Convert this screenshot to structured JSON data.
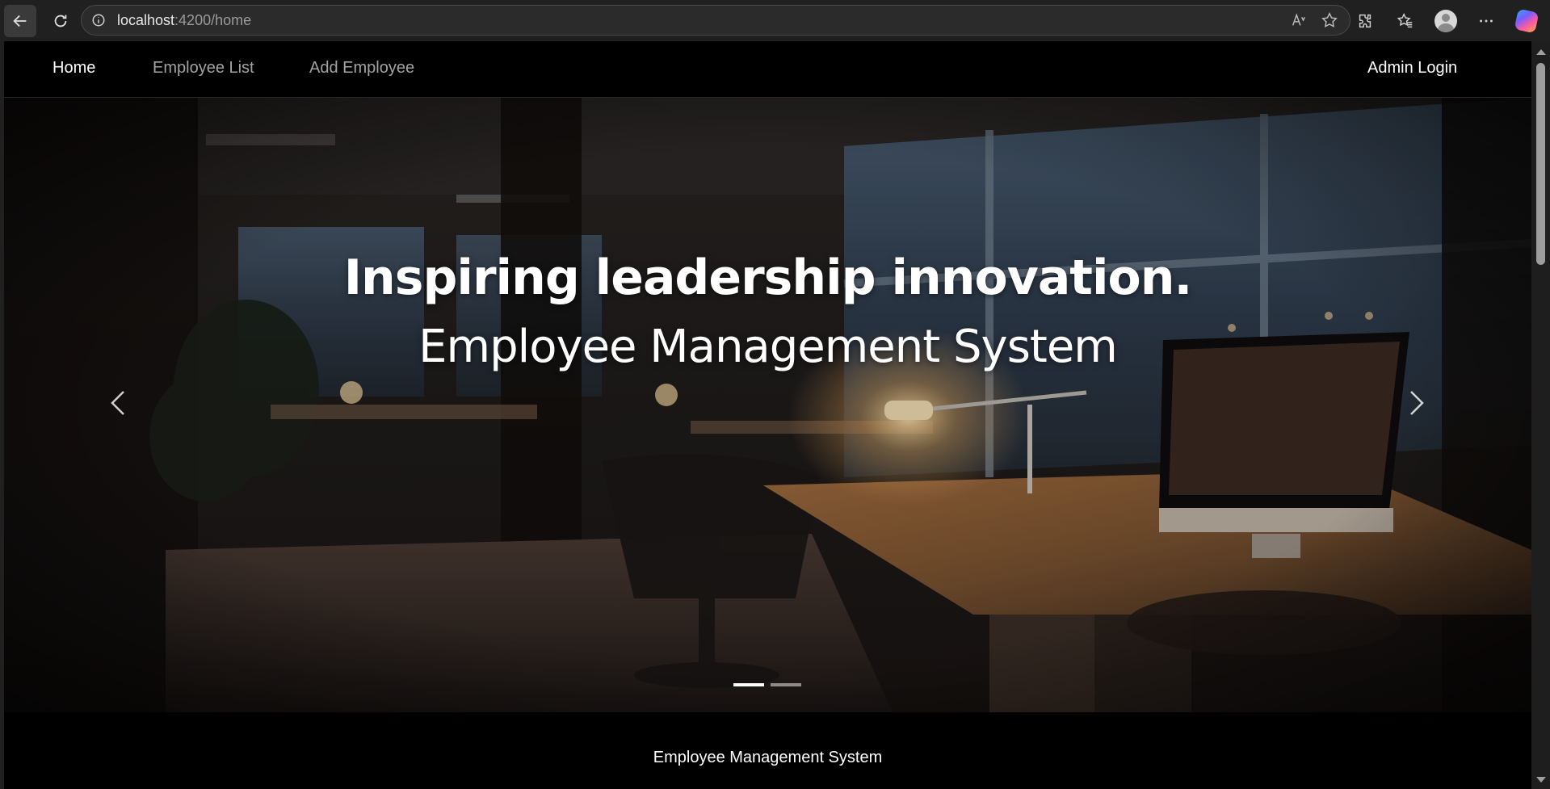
{
  "browser": {
    "url_host": "localhost",
    "url_path": ":4200/home",
    "icons": [
      "back-arrow-icon",
      "reload-icon",
      "site-info-icon",
      "read-aloud-icon",
      "favorite-star-icon",
      "extensions-icon",
      "favorites-icon",
      "profile-icon",
      "more-icon",
      "copilot-icon"
    ]
  },
  "navbar": {
    "home": "Home",
    "employee_list": "Employee List",
    "add_employee": "Add Employee",
    "admin_login": "Admin Login"
  },
  "carousel": {
    "title": "Inspiring leadership innovation.",
    "subtitle": "Employee Management System",
    "slide_count": 2,
    "active_slide": 1
  },
  "footer": {
    "text": "Employee Management System"
  }
}
